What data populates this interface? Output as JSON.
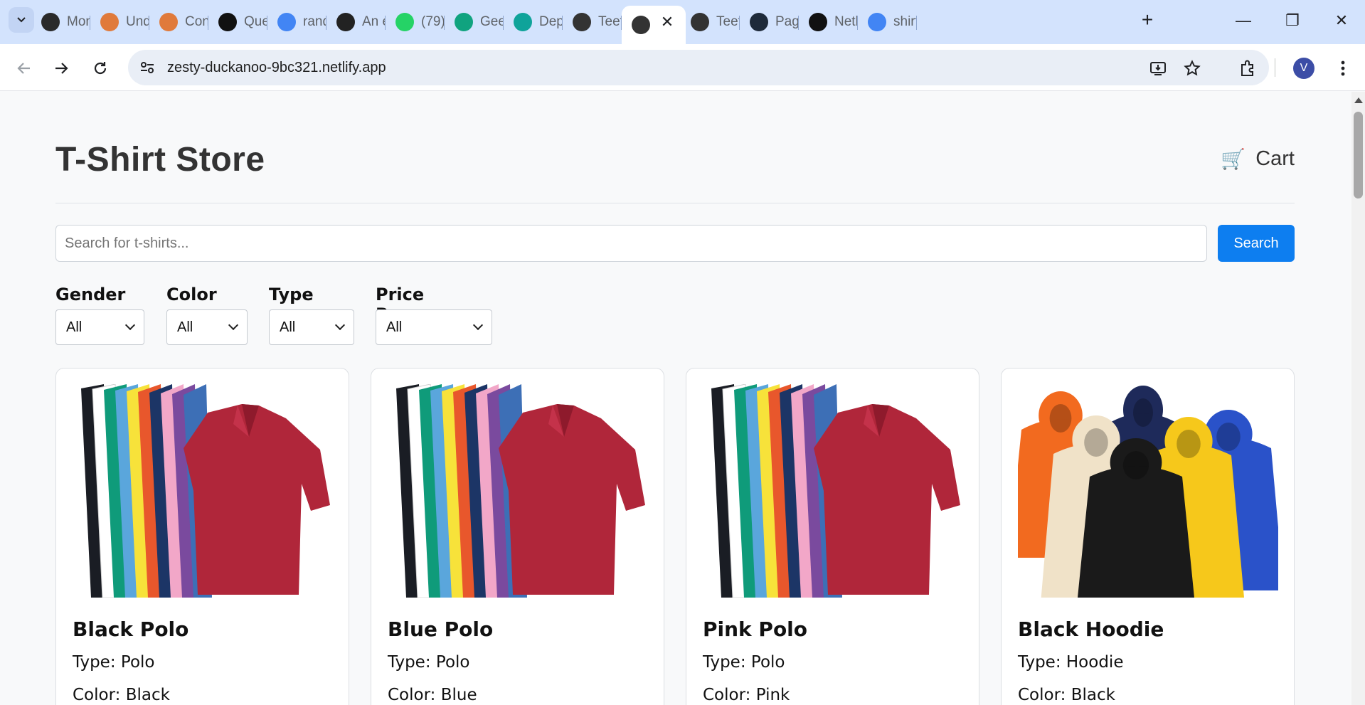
{
  "browser": {
    "url": "zesty-duckanoo-9bc321.netlify.app",
    "avatar_letter": "V",
    "tabs": [
      {
        "label": "Mon",
        "icon": "mt-logo-icon",
        "color": "#2a2a2a"
      },
      {
        "label": "Und",
        "icon": "profile-badge-icon",
        "color": "#e07a3b"
      },
      {
        "label": "Con",
        "icon": "profile-badge-icon",
        "color": "#e07a3b"
      },
      {
        "label": "Que",
        "icon": "openai-logo-icon",
        "color": "#111111"
      },
      {
        "label": "rand",
        "icon": "google-logo-icon",
        "color": "#4285f4"
      },
      {
        "label": "An e",
        "icon": "r6-logo-icon",
        "color": "#222222"
      },
      {
        "label": "(79)",
        "icon": "whatsapp-icon",
        "color": "#25d366"
      },
      {
        "label": "Gee",
        "icon": "chatgpt-green-icon",
        "color": "#10a37f"
      },
      {
        "label": "Dep",
        "icon": "netlify-logo-icon",
        "color": "#0fa39a"
      },
      {
        "label": "Teef",
        "icon": "tshirt-favicon-icon",
        "color": "#333333"
      },
      {
        "label": "",
        "icon": "tshirt-favicon-icon",
        "color": "#333333",
        "active": true
      },
      {
        "label": "Teef",
        "icon": "tshirt-favicon-icon",
        "color": "#333333"
      },
      {
        "label": "Pag",
        "icon": "react-logo-icon",
        "color": "#1e2a3a"
      },
      {
        "label": "Netl",
        "icon": "openai-logo-icon",
        "color": "#111111"
      },
      {
        "label": "shirt",
        "icon": "google-logo-icon",
        "color": "#4285f4"
      }
    ]
  },
  "store": {
    "title": "T-Shirt Store",
    "cart_label": "Cart",
    "cart_icon": "🛒",
    "search": {
      "placeholder": "Search for t-shirts...",
      "value": "",
      "button": "Search"
    },
    "filters": [
      {
        "label": "Gender",
        "value": "All"
      },
      {
        "label": "Color",
        "value": "All"
      },
      {
        "label": "Type",
        "value": "All"
      },
      {
        "label": "Price Range",
        "value": "All"
      }
    ],
    "products": [
      {
        "name": "Black Polo",
        "type": "Type: Polo",
        "color": "Color: Black",
        "image": "polo-shirts-image"
      },
      {
        "name": "Blue Polo",
        "type": "Type: Polo",
        "color": "Color: Blue",
        "image": "polo-shirts-image"
      },
      {
        "name": "Pink Polo",
        "type": "Type: Polo",
        "color": "Color: Pink",
        "image": "polo-shirts-image"
      },
      {
        "name": "Black Hoodie",
        "type": "Type: Hoodie",
        "color": "Color: Black",
        "image": "hoodies-image"
      }
    ]
  },
  "colors": {
    "tabstrip": "#d3e3fd",
    "accent_button": "#0d7ef0",
    "polo_colors": [
      "#1a1d24",
      "#ffffff",
      "#0f9b7a",
      "#5aa6dc",
      "#f7e23a",
      "#e8572c",
      "#1c3566",
      "#f2a7c8",
      "#7a4a9e",
      "#3d6fb6",
      "#b0263a"
    ],
    "hoodie_colors": [
      "#f26a1f",
      "#1e2a5a",
      "#2a52c9",
      "#f0e2c8",
      "#1a1a1a",
      "#f6c81b"
    ]
  }
}
